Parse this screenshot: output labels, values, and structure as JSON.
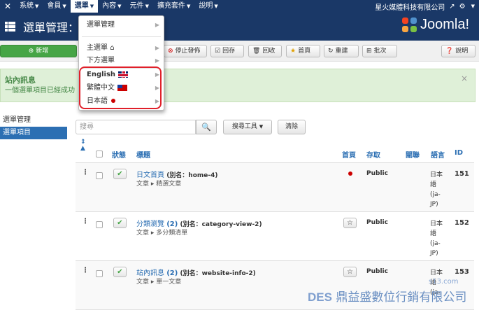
{
  "navbar": {
    "logo": "✕",
    "items": [
      "系統",
      "會員",
      "選單",
      "內容",
      "元件",
      "擴充套件",
      "說明"
    ],
    "site_name": "星火媒體科技有限公司",
    "ext_icon": "↗",
    "gear_icon": "⚙"
  },
  "header": {
    "title": "選單管理：",
    "brand": "Joomla!"
  },
  "toolbar": {
    "new": "新增",
    "unpublish": "停止發佈",
    "checkin": "回存",
    "trash": "回收",
    "home": "首頁",
    "rebuild": "重建",
    "batch": "批次",
    "help": "說明"
  },
  "alert": {
    "heading": "站內訊息",
    "message": "一個選單項目已經成功",
    "close": "×"
  },
  "sidebar": {
    "items": [
      "選單管理",
      "選單項目"
    ]
  },
  "search": {
    "placeholder": "搜尋",
    "tools_label": "搜尋工具",
    "clear_label": "清除"
  },
  "table": {
    "headers": {
      "status": "狀態",
      "title": "標題",
      "home": "首頁",
      "access": "存取",
      "assoc": "關聯",
      "language": "語言",
      "id": "ID"
    },
    "rows": [
      {
        "title": "日文首頁",
        "count": "",
        "alias": "(別名：home-4)",
        "sub": "文章 ▸ 精選文章",
        "home": "dot",
        "access": "Public",
        "language": "日本語 (ja-JP)",
        "id": "151"
      },
      {
        "title": "分類瀏覽",
        "count": "(2)",
        "alias": "(別名：category-view-2)",
        "sub": "文章 ▸ 多分類清單",
        "home": "star",
        "access": "Public",
        "language": "日本語 (ja-JP)",
        "id": "152"
      },
      {
        "title": "站內訊息",
        "count": "(2)",
        "alias": "(別名：website-info-2)",
        "sub": "文章 ▸ 單一文章",
        "home": "star",
        "access": "Public",
        "language": "日本語 (ja-",
        "id": "153"
      }
    ]
  },
  "dropdown": {
    "items": [
      "選單管理",
      "主選單",
      "下方選單",
      "English",
      "繁體中文",
      "日本語"
    ]
  },
  "watermark": {
    "brand": "DES",
    "company": "鼎益盛數位行銷有限公司",
    "url": "s13.com"
  },
  "colors": {
    "navbar": "#1a3867",
    "accent": "#2c6fb3",
    "success": "#46a546",
    "highlight": "#e0202a"
  }
}
